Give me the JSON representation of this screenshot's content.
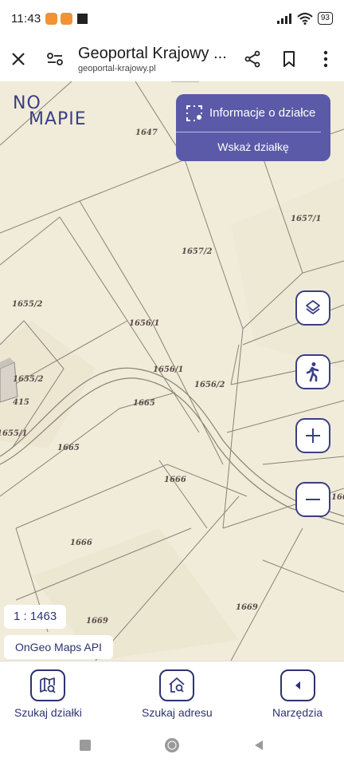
{
  "status_bar": {
    "time": "11:43",
    "battery": "93"
  },
  "browser": {
    "title": "Geoportal Krajowy ...",
    "url": "geoportal-krajowy.pl",
    "close_icon": "close-icon",
    "site_settings_icon": "tune-icon",
    "share_icon": "share-icon",
    "bookmark_icon": "bookmark-icon",
    "menu_icon": "more-vert-icon"
  },
  "logo": {
    "line1": "NO",
    "line2": "MAPIE"
  },
  "info_panel": {
    "title": "Informacje o działce",
    "action": "Wskaż działkę"
  },
  "map_controls": {
    "layers": "layers-icon",
    "walk": "walk-icon",
    "zoom_in": "zoom-in-icon",
    "zoom_out": "zoom-out-icon"
  },
  "parcel_labels": {
    "p1647": "1647",
    "p1657_1": "1657/1",
    "p1657_2": "1657/2",
    "p1655_2a": "1655/2",
    "p1656_1a": "1656/1",
    "p1656_1b": "1656/1",
    "p1655_2b": "1655/2",
    "p1656_2": "1656/2",
    "p415": "415",
    "p1665a": "1665",
    "p1655_1": "1655/1",
    "p1665b": "1665",
    "p1666a": "1666",
    "p1666b": "1666",
    "p1669a": "1669",
    "p1669b": "1669",
    "p166_edge": "166"
  },
  "scale": "1 : 1463",
  "api_badge": "OnGeo Maps API",
  "bottom_nav": [
    {
      "label": "Szukaj działki",
      "icon": "map-search-icon"
    },
    {
      "label": "Szukaj adresu",
      "icon": "home-search-icon"
    },
    {
      "label": "Narzędzia",
      "icon": "chevron-left-icon"
    }
  ],
  "colors": {
    "accent": "#3b3f84",
    "panel": "#5b5aa8",
    "map_bg": "#f0ecd9"
  }
}
